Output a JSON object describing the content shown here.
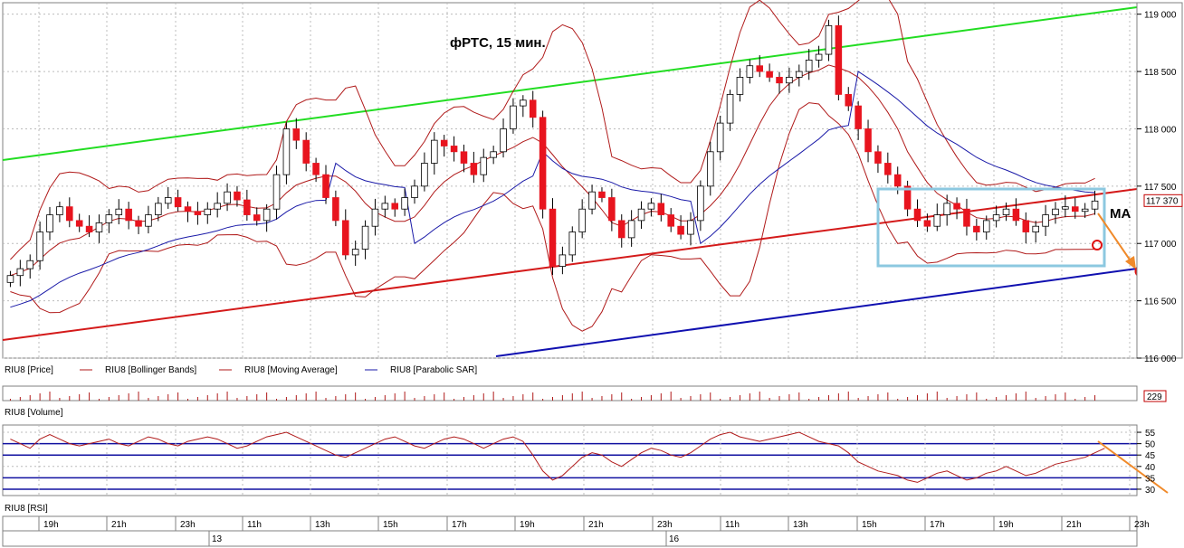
{
  "title": "фРТС, 15 мин.",
  "ma_label": "MA",
  "colors": {
    "bull": "#ffffff",
    "bear": "#e8141e",
    "bollinger": "#b01a1a",
    "sar": "#1a1aa8",
    "channel_top": "#22dd22",
    "channel_mid": "#d41a1a",
    "channel_bottom": "#1010b0",
    "highlight_box": "#8cc8e0",
    "arrow": "#f08a2a",
    "grid": "#bcbcbc"
  },
  "legend": [
    {
      "name": "RIU8 [Price]"
    },
    {
      "name": "RIU8 [Bollinger Bands]"
    },
    {
      "name": "RIU8 [Moving Average]"
    },
    {
      "name": "RIU8 [Parabolic SAR]"
    }
  ],
  "volume_panel": {
    "label": "RIU8 [Volume]",
    "last_value": "229"
  },
  "rsi_panel": {
    "label": "RIU8 [RSI]",
    "levels": [
      55,
      50,
      45,
      40,
      35,
      30
    ]
  },
  "time_axis": {
    "hours": [
      "19h",
      "21h",
      "23h",
      "11h",
      "13h",
      "15h",
      "17h",
      "19h",
      "21h",
      "23h",
      "11h",
      "13h",
      "15h",
      "17h",
      "19h",
      "21h",
      "23h"
    ],
    "days": [
      "13",
      "16"
    ]
  },
  "chart_data": {
    "type": "candlestick",
    "title": "фРТС, 15 мин.",
    "ylim": [
      116000,
      119100
    ],
    "y_ticks": [
      "116 000",
      "116 500",
      "117 000",
      "117 500",
      "118 000",
      "118 500",
      "119 000"
    ],
    "y_tick_values": [
      116000,
      116500,
      117000,
      117500,
      118000,
      118500,
      119000
    ],
    "last_price": "117 370",
    "last_price_value": 117370,
    "series": [
      {
        "name": "RIU8 [Price]",
        "close": [
          116720,
          116780,
          116850,
          117100,
          117250,
          117320,
          117200,
          117150,
          117100,
          117180,
          117250,
          117300,
          117200,
          117150,
          117250,
          117350,
          117400,
          117320,
          117280,
          117250,
          117300,
          117350,
          117450,
          117380,
          117250,
          117200,
          117300,
          117600,
          118000,
          117900,
          117700,
          117600,
          117400,
          117200,
          116900,
          116950,
          117150,
          117300,
          117350,
          117300,
          117400,
          117500,
          117700,
          117900,
          117850,
          117800,
          117700,
          117600,
          117750,
          117800,
          118000,
          118200,
          118250,
          118100,
          117300,
          116800,
          116900,
          117100,
          117300,
          117450,
          117400,
          117200,
          117050,
          117200,
          117300,
          117350,
          117250,
          117150,
          117080,
          117200,
          117500,
          117800,
          118050,
          118300,
          118450,
          118550,
          118500,
          118450,
          118400,
          118450,
          118500,
          118600,
          118650,
          118900,
          118300,
          118200,
          118000,
          117800,
          117700,
          117600,
          117500,
          117300,
          117200,
          117150,
          117250,
          117350,
          117300,
          117150,
          117100,
          117200,
          117250,
          117300,
          117200,
          117100,
          117150,
          117250,
          117300,
          117320,
          117280,
          117300,
          117370
        ]
      }
    ],
    "rsi": [
      52,
      50,
      48,
      52,
      54,
      52,
      50,
      49,
      50,
      51,
      52,
      50,
      49,
      51,
      53,
      52,
      50,
      49,
      51,
      52,
      53,
      52,
      50,
      48,
      49,
      51,
      53,
      54,
      55,
      53,
      51,
      49,
      47,
      45,
      44,
      46,
      48,
      50,
      52,
      53,
      51,
      49,
      48,
      50,
      52,
      53,
      52,
      50,
      48,
      50,
      52,
      53,
      51,
      45,
      38,
      34,
      36,
      40,
      44,
      46,
      45,
      42,
      40,
      43,
      46,
      48,
      47,
      45,
      44,
      46,
      49,
      52,
      54,
      55,
      53,
      52,
      51,
      52,
      53,
      54,
      55,
      53,
      51,
      50,
      49,
      46,
      42,
      40,
      38,
      37,
      36,
      34,
      33,
      35,
      37,
      38,
      36,
      34,
      35,
      37,
      38,
      40,
      38,
      36,
      37,
      39,
      41,
      42,
      43,
      44,
      46,
      48
    ]
  }
}
